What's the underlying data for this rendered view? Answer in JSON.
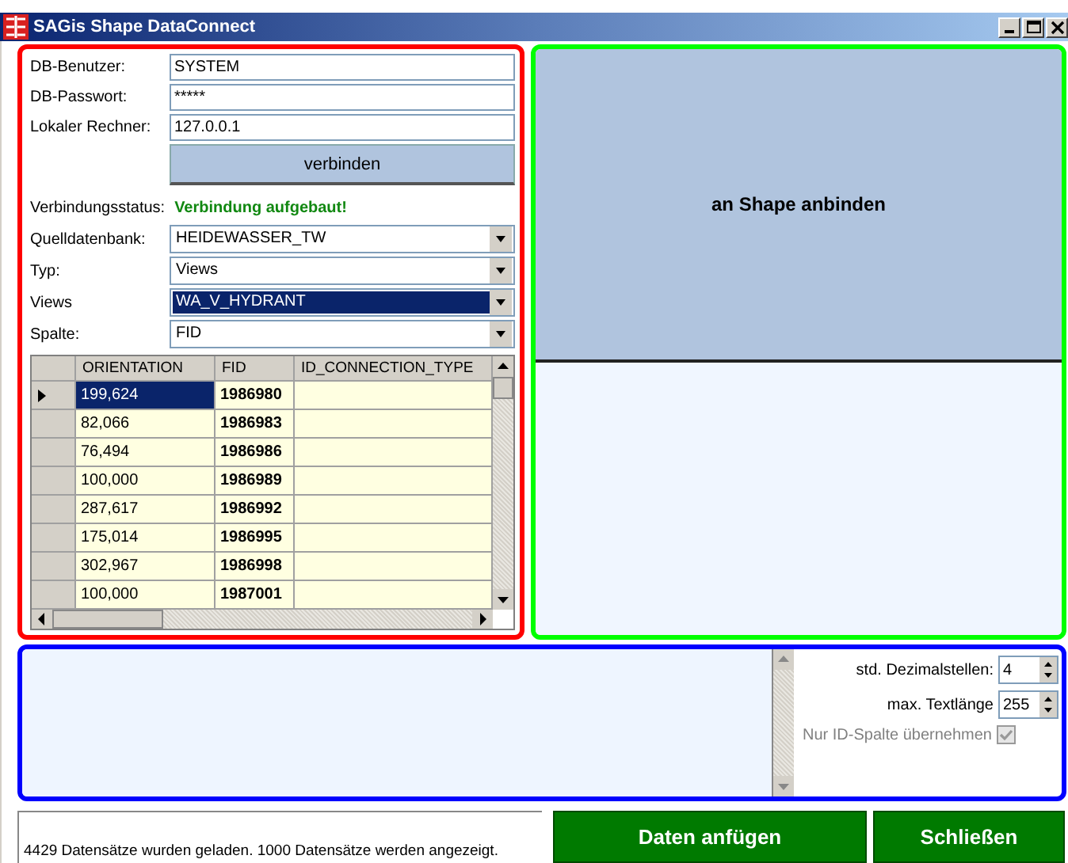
{
  "window": {
    "title": "SAGis Shape DataConnect"
  },
  "connection": {
    "fields": [
      {
        "label": "DB-Benutzer:",
        "value": "SYSTEM"
      },
      {
        "label": "DB-Passwort:",
        "value": "*****"
      },
      {
        "label": "Lokaler Rechner:",
        "value": "127.0.0.1"
      }
    ],
    "connect_button": "verbinden",
    "status_label": "Verbindungsstatus:",
    "status_value": "Verbindung aufgebaut!"
  },
  "selectors": [
    {
      "label": "Quelldatenbank:",
      "value": "HEIDEWASSER_TW",
      "focused": false
    },
    {
      "label": "Typ:",
      "value": "Views",
      "focused": false
    },
    {
      "label": "Views",
      "value": "WA_V_HYDRANT",
      "focused": true
    },
    {
      "label": "Spalte:",
      "value": "FID",
      "focused": false
    }
  ],
  "table": {
    "columns": [
      "ORIENTATION",
      "FID",
      "ID_CONNECTION_TYPE"
    ],
    "rows": [
      {
        "cells": [
          "199,624",
          "1986980",
          ""
        ],
        "selected": true
      },
      {
        "cells": [
          "82,066",
          "1986983",
          ""
        ],
        "selected": false
      },
      {
        "cells": [
          "76,494",
          "1986986",
          ""
        ],
        "selected": false
      },
      {
        "cells": [
          "100,000",
          "1986989",
          ""
        ],
        "selected": false
      },
      {
        "cells": [
          "287,617",
          "1986992",
          ""
        ],
        "selected": false
      },
      {
        "cells": [
          "175,014",
          "1986995",
          ""
        ],
        "selected": false
      },
      {
        "cells": [
          "302,967",
          "1986998",
          ""
        ],
        "selected": false
      },
      {
        "cells": [
          "100,000",
          "1987001",
          ""
        ],
        "selected": false
      }
    ]
  },
  "shape_button": "an Shape anbinden",
  "options": {
    "decimals_label": "std. Dezimalstellen:",
    "decimals": "4",
    "textlen_label": "max. Textlänge",
    "textlen": "255",
    "id_only_label": "Nur ID-Spalte übernehmen",
    "id_only_checked": true,
    "id_only_disabled": true
  },
  "status_bar": "4429 Datensätze wurden geladen. 1000 Datensätze werden angezeigt.",
  "buttons": [
    "Daten anfügen",
    "Schließen"
  ]
}
